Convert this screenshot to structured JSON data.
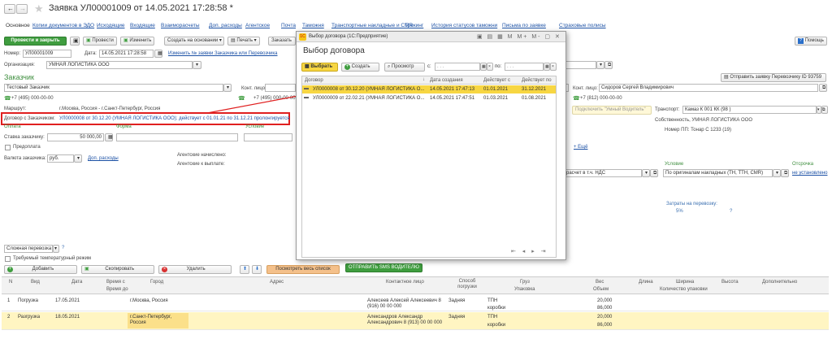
{
  "window": {
    "title": "Заявка УЛ00001009 от 14.05.2021 17:28:58 *"
  },
  "tabs": [
    "Основное",
    "Копии документов в ЭДО",
    "Исходящие",
    "Входящие",
    "Взаиморасчеты",
    "Доп. расходы",
    "Агентское",
    "Почта",
    "Таможня",
    "Транспортные накладные и CMR",
    "Трекинг",
    "История статусов таможни",
    "Письма по заявке",
    "Страховые полисы"
  ],
  "toolbar": {
    "post_close": "Провести и закрыть",
    "post": "Провести",
    "edit": "Изменить",
    "create_basis": "Создать на основании",
    "print": "Печать",
    "order": "Заказать",
    "help": "Помощь"
  },
  "form": {
    "number_label": "Номер:",
    "number": "УЛ00001009",
    "date_label": "Дата:",
    "date": "14.05.2021 17:28:58",
    "carrier_link": "Изменить № заявки Заказчика или Перевозчика",
    "org_label": "Организация:",
    "org": "УМНАЯ ЛОГИСТИКА ООО",
    "customer_section": "Заказчик",
    "customer": "Тестовый Заказчик",
    "contact_label": "Конт. лицо:",
    "phone": "+7 (495) 000-00-00",
    "phone_r": "+7 (495) 000-00-00",
    "route_label": "Маршрут:",
    "route": "г.Москва, Россия - г.Санкт-Петербург, Россия",
    "contract_label": "Договор с Заказчиком:",
    "contract": "УЛ0000008 от 30.12.20 (УМНАЯ ЛОГИСТИКА ООО); действует с 01.01.21 по 31.12.21 пролонгируется",
    "payment": "Оплата",
    "form_label": "Форма",
    "condition": "Условие",
    "rate_label": "Ставка заказчику:",
    "rate": "50 000,00",
    "prepay": "Предоплата",
    "currency_label": "Валюта заказчика:",
    "currency": "руб.",
    "extra_link": "Доп. расходы",
    "agent_accrued": "Агентские начислено:",
    "agent_payout": "Агентские к выплате:",
    "right_contact_label": "Конт. лицо:",
    "right_contact": "Сидоров Сергей Владимирович",
    "right_phone": "+7 (812) 000-00-00",
    "send_carrier": "Отправить заявку Перевозчику ID 93759",
    "smart_driver": "Подключить \"Умный Водитель\"",
    "transport_label": "Транспорт:",
    "transport": "Камаз К 001 КК (98 )",
    "owner": "Собственность, УМНАЯ ЛОГИСТИКА ООО",
    "trailer": "Номер ПП: Тонар С 1233 (19)",
    "add_link": "+ Ещё",
    "cond2": "Условие",
    "delay": "Отсрочка",
    "vat": "расчет в т.ч. НДС",
    "by_docs": "По оригиналам накладных (ТН, ТТН, CMR)",
    "not_set": "не установлено",
    "costs_label": "Затраты на перевозку:",
    "costs_pct": "5%",
    "q": "?",
    "complex": "Сложная перевозка",
    "temp": "Требуемый температурный режим"
  },
  "table_toolbar": {
    "add": "Добавить",
    "copy": "Скопировать",
    "delete": "Удалить",
    "view_list": "Посмотреть весь список",
    "sms": "ОТПРАВИТЬ SMS ВОДИТЕЛЮ"
  },
  "table": {
    "headers": [
      "N",
      "Вид",
      "Дата",
      "Время с",
      "Город",
      "Адрес",
      "Контактное лицо",
      "Способ погрузки",
      "Груз",
      "Вес",
      "Длина",
      "Ширина",
      "Высота",
      "Дополнительно"
    ],
    "headers2": {
      "time_to": "Время до",
      "pack": "Упаковка",
      "volume": "Объем",
      "qty": "Количество упаковки"
    },
    "rows": [
      {
        "n": "1",
        "kind": "Погрузка",
        "date": "17.05.2021",
        "city": "г.Москва, Россия",
        "contact1": "Алексеев Алексей Алексеевич 8",
        "contact2": "(916) 00 00 000",
        "method": "Задняя",
        "cargo": "ТПН",
        "pack": "коробки",
        "weight": "20,000",
        "volume": "86,000"
      },
      {
        "n": "2",
        "kind": "Разгрузка",
        "date": "18.05.2021",
        "city": "г.Санкт-Петербург,",
        "city2": "Россия",
        "contact1": "Александров Александр",
        "contact2": "Александрович 8 (913) 00 00 000",
        "method": "Задняя",
        "cargo": "ТПН",
        "pack": "коробки",
        "weight": "20,000",
        "volume": "86,000"
      }
    ]
  },
  "dialog": {
    "titlebar": "Выбор договора (1С:Предприятие)",
    "title": "Выбор договора",
    "select": "Выбрать",
    "create": "Создать",
    "view": "Просмотр",
    "from": "с:",
    "to": "по:",
    "headers": [
      "Договор",
      "Дата создания",
      "Действует с",
      "Действует по"
    ],
    "rows": [
      {
        "name": "УЛ0000008 от 30.12.20 (УМНАЯ ЛОГИСТИКА О...",
        "created": "14.05.2021 17:47:13",
        "from": "01.01.2021",
        "to": "31.12.2021"
      },
      {
        "name": "УЛ0000009 от 22.02.21 (УМНАЯ ЛОГИСТИКА О...",
        "created": "14.05.2021 17:47:51",
        "from": "01.03.2021",
        "to": "01.08.2021"
      }
    ]
  },
  "colors": {
    "accent": "#3f9d3f",
    "highlight": "#fff5c2",
    "annotation": "#e02020",
    "link": "#1c51a5"
  }
}
